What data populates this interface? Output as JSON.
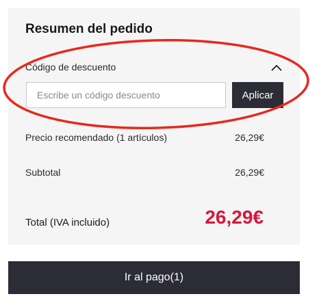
{
  "summary": {
    "title": "Resumen del pedido",
    "discount_label": "Código de descuento",
    "discount_placeholder": "Escribe un código descuento",
    "discount_value": "",
    "apply_label": "Aplicar",
    "rows": [
      {
        "label": "Precio recomendado (1 artículos)",
        "value": "26,29€"
      },
      {
        "label": "Subtotal",
        "value": "26,29€"
      }
    ],
    "total_label": "Total (IVA incluido)",
    "total_value": "26,29€"
  },
  "checkout": {
    "label": "Ir al pago(1)"
  },
  "icons": {
    "collapse": "chevron-up-icon"
  },
  "colors": {
    "accent_dark": "#2c2c36",
    "total_red": "#d6163b",
    "highlight_red": "#e8281c",
    "panel_bg": "#f5f5f5"
  }
}
